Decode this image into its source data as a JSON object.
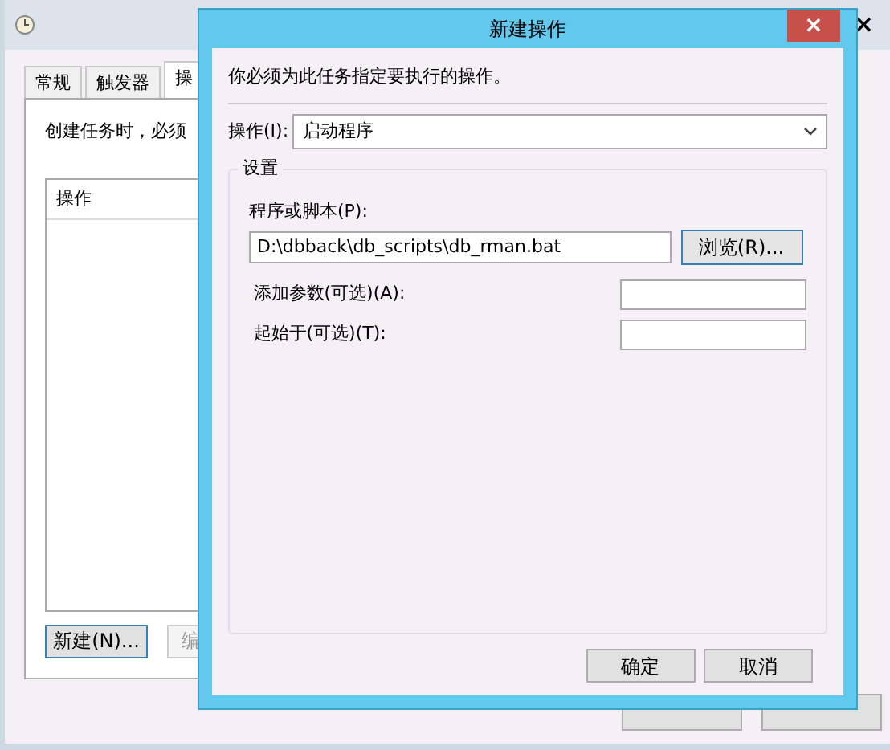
{
  "background_window": {
    "close": "×",
    "tabs": [
      {
        "label": "常规",
        "selected": false
      },
      {
        "label": "触发器",
        "selected": false
      },
      {
        "label": "操",
        "selected": true
      }
    ],
    "description": "创建任务时，必须",
    "actions_list": {
      "columns": [
        "操作"
      ]
    },
    "buttons": [
      {
        "label": "新建(N)...",
        "disabled": false
      },
      {
        "label": "编",
        "disabled": true
      }
    ]
  },
  "dialog": {
    "title": "新建操作",
    "close": "×",
    "instruction": "你必须为此任务指定要执行的操作。",
    "action_label": "操作(I):",
    "action_value": "启动程序",
    "settings": {
      "title": "设置",
      "program_label": "程序或脚本(P):",
      "program_value": "D:\\dbback\\db_scripts\\db_rman.bat",
      "browse_button": "浏览(R)...",
      "fields": [
        {
          "label": "添加参数(可选)(A):"
        },
        {
          "label": "起始于(可选)(T):"
        }
      ]
    },
    "buttons": [
      "确定",
      "取消"
    ]
  }
}
